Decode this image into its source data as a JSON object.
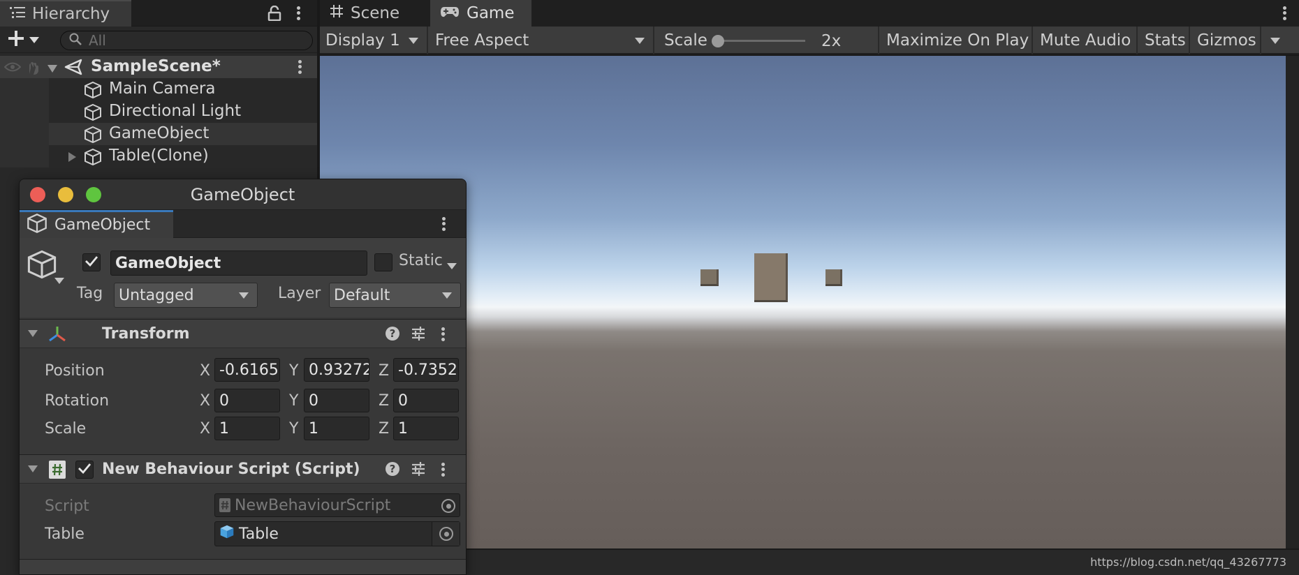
{
  "hierarchy": {
    "tab_label": "Hierarchy",
    "search_placeholder": "All",
    "scene_name": "SampleScene*",
    "items": [
      {
        "label": "Main Camera"
      },
      {
        "label": "Directional Light"
      },
      {
        "label": "GameObject",
        "selected": true
      },
      {
        "label": "Table(Clone)",
        "has_children": true
      }
    ]
  },
  "game_view": {
    "tabs": [
      {
        "label": "Scene",
        "icon": "grid-icon"
      },
      {
        "label": "Game",
        "icon": "gamepad-icon",
        "active": true
      }
    ],
    "toolbar": {
      "display": "Display 1",
      "aspect": "Free Aspect",
      "scale_label": "Scale",
      "scale_value": "2x",
      "maximize": "Maximize On Play",
      "mute": "Mute Audio",
      "stats": "Stats",
      "gizmos": "Gizmos"
    },
    "watermark": "https://blog.csdn.net/qq_43267773"
  },
  "inspector": {
    "window_title": "GameObject",
    "tab_label": "GameObject",
    "object": {
      "active": true,
      "name": "GameObject",
      "static_label": "Static",
      "static": false,
      "tag_label": "Tag",
      "tag": "Untagged",
      "layer_label": "Layer",
      "layer": "Default"
    },
    "transform": {
      "title": "Transform",
      "position_label": "Position",
      "rotation_label": "Rotation",
      "scale_label": "Scale",
      "axis_x": "X",
      "axis_y": "Y",
      "axis_z": "Z",
      "position": {
        "x": "-0.6165",
        "y": "0.93272",
        "z": "-0.7352"
      },
      "rotation": {
        "x": "0",
        "y": "0",
        "z": "0"
      },
      "scale": {
        "x": "1",
        "y": "1",
        "z": "1"
      }
    },
    "script_component": {
      "title": "New Behaviour Script (Script)",
      "enabled": true,
      "script_label": "Script",
      "script_value": "NewBehaviourScript",
      "table_label": "Table",
      "table_value": "Table"
    }
  },
  "colors": {
    "accent_blue": "#3a79bb",
    "close": "#ed5e57",
    "minimize": "#e9bd3c",
    "maximize": "#5fc53f"
  }
}
